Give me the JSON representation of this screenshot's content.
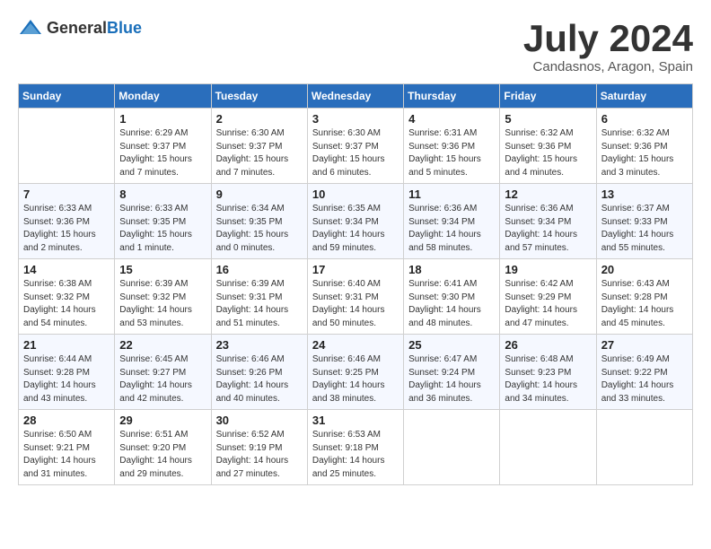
{
  "header": {
    "logo_general": "General",
    "logo_blue": "Blue",
    "title": "July 2024",
    "location": "Candasnos, Aragon, Spain"
  },
  "weekdays": [
    "Sunday",
    "Monday",
    "Tuesday",
    "Wednesday",
    "Thursday",
    "Friday",
    "Saturday"
  ],
  "weeks": [
    [
      {
        "day": "",
        "info": ""
      },
      {
        "day": "1",
        "info": "Sunrise: 6:29 AM\nSunset: 9:37 PM\nDaylight: 15 hours\nand 7 minutes."
      },
      {
        "day": "2",
        "info": "Sunrise: 6:30 AM\nSunset: 9:37 PM\nDaylight: 15 hours\nand 7 minutes."
      },
      {
        "day": "3",
        "info": "Sunrise: 6:30 AM\nSunset: 9:37 PM\nDaylight: 15 hours\nand 6 minutes."
      },
      {
        "day": "4",
        "info": "Sunrise: 6:31 AM\nSunset: 9:36 PM\nDaylight: 15 hours\nand 5 minutes."
      },
      {
        "day": "5",
        "info": "Sunrise: 6:32 AM\nSunset: 9:36 PM\nDaylight: 15 hours\nand 4 minutes."
      },
      {
        "day": "6",
        "info": "Sunrise: 6:32 AM\nSunset: 9:36 PM\nDaylight: 15 hours\nand 3 minutes."
      }
    ],
    [
      {
        "day": "7",
        "info": "Sunrise: 6:33 AM\nSunset: 9:36 PM\nDaylight: 15 hours\nand 2 minutes."
      },
      {
        "day": "8",
        "info": "Sunrise: 6:33 AM\nSunset: 9:35 PM\nDaylight: 15 hours\nand 1 minute."
      },
      {
        "day": "9",
        "info": "Sunrise: 6:34 AM\nSunset: 9:35 PM\nDaylight: 15 hours\nand 0 minutes."
      },
      {
        "day": "10",
        "info": "Sunrise: 6:35 AM\nSunset: 9:34 PM\nDaylight: 14 hours\nand 59 minutes."
      },
      {
        "day": "11",
        "info": "Sunrise: 6:36 AM\nSunset: 9:34 PM\nDaylight: 14 hours\nand 58 minutes."
      },
      {
        "day": "12",
        "info": "Sunrise: 6:36 AM\nSunset: 9:34 PM\nDaylight: 14 hours\nand 57 minutes."
      },
      {
        "day": "13",
        "info": "Sunrise: 6:37 AM\nSunset: 9:33 PM\nDaylight: 14 hours\nand 55 minutes."
      }
    ],
    [
      {
        "day": "14",
        "info": "Sunrise: 6:38 AM\nSunset: 9:32 PM\nDaylight: 14 hours\nand 54 minutes."
      },
      {
        "day": "15",
        "info": "Sunrise: 6:39 AM\nSunset: 9:32 PM\nDaylight: 14 hours\nand 53 minutes."
      },
      {
        "day": "16",
        "info": "Sunrise: 6:39 AM\nSunset: 9:31 PM\nDaylight: 14 hours\nand 51 minutes."
      },
      {
        "day": "17",
        "info": "Sunrise: 6:40 AM\nSunset: 9:31 PM\nDaylight: 14 hours\nand 50 minutes."
      },
      {
        "day": "18",
        "info": "Sunrise: 6:41 AM\nSunset: 9:30 PM\nDaylight: 14 hours\nand 48 minutes."
      },
      {
        "day": "19",
        "info": "Sunrise: 6:42 AM\nSunset: 9:29 PM\nDaylight: 14 hours\nand 47 minutes."
      },
      {
        "day": "20",
        "info": "Sunrise: 6:43 AM\nSunset: 9:28 PM\nDaylight: 14 hours\nand 45 minutes."
      }
    ],
    [
      {
        "day": "21",
        "info": "Sunrise: 6:44 AM\nSunset: 9:28 PM\nDaylight: 14 hours\nand 43 minutes."
      },
      {
        "day": "22",
        "info": "Sunrise: 6:45 AM\nSunset: 9:27 PM\nDaylight: 14 hours\nand 42 minutes."
      },
      {
        "day": "23",
        "info": "Sunrise: 6:46 AM\nSunset: 9:26 PM\nDaylight: 14 hours\nand 40 minutes."
      },
      {
        "day": "24",
        "info": "Sunrise: 6:46 AM\nSunset: 9:25 PM\nDaylight: 14 hours\nand 38 minutes."
      },
      {
        "day": "25",
        "info": "Sunrise: 6:47 AM\nSunset: 9:24 PM\nDaylight: 14 hours\nand 36 minutes."
      },
      {
        "day": "26",
        "info": "Sunrise: 6:48 AM\nSunset: 9:23 PM\nDaylight: 14 hours\nand 34 minutes."
      },
      {
        "day": "27",
        "info": "Sunrise: 6:49 AM\nSunset: 9:22 PM\nDaylight: 14 hours\nand 33 minutes."
      }
    ],
    [
      {
        "day": "28",
        "info": "Sunrise: 6:50 AM\nSunset: 9:21 PM\nDaylight: 14 hours\nand 31 minutes."
      },
      {
        "day": "29",
        "info": "Sunrise: 6:51 AM\nSunset: 9:20 PM\nDaylight: 14 hours\nand 29 minutes."
      },
      {
        "day": "30",
        "info": "Sunrise: 6:52 AM\nSunset: 9:19 PM\nDaylight: 14 hours\nand 27 minutes."
      },
      {
        "day": "31",
        "info": "Sunrise: 6:53 AM\nSunset: 9:18 PM\nDaylight: 14 hours\nand 25 minutes."
      },
      {
        "day": "",
        "info": ""
      },
      {
        "day": "",
        "info": ""
      },
      {
        "day": "",
        "info": ""
      }
    ]
  ]
}
